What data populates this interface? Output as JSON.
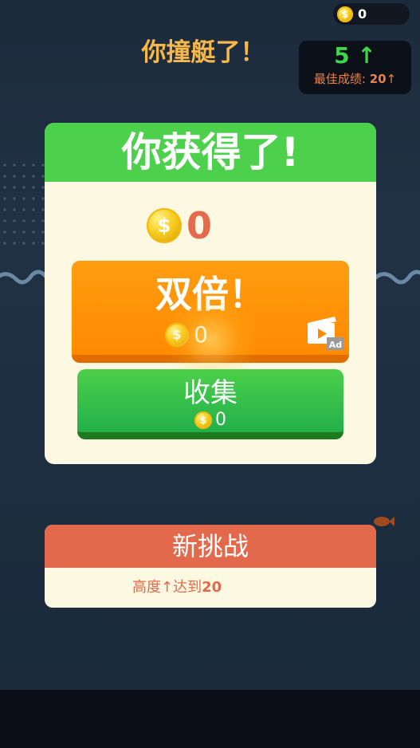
{
  "hud": {
    "coins": "0"
  },
  "crash": {
    "title": "你撞艇了！"
  },
  "score": {
    "current": "5",
    "arrow": "↑",
    "best_label": "最佳成绩:",
    "best_value": "20",
    "best_arrow": "↑"
  },
  "reward": {
    "heading": "你获得了!",
    "amount": "0",
    "double": {
      "label": "双倍！",
      "amount": "0",
      "ad_badge": "Ad"
    },
    "collect": {
      "label": "收集",
      "amount": "0"
    },
    "coin_symbol": "$"
  },
  "challenge": {
    "heading": "新挑战",
    "text": "高度↑达到",
    "target": "20"
  },
  "colors": {
    "green": "#4dd04c",
    "orange": "#ff8a00",
    "red": "#e2694c",
    "panel": "#fdf8e1",
    "gold": "#f7cc1c"
  }
}
